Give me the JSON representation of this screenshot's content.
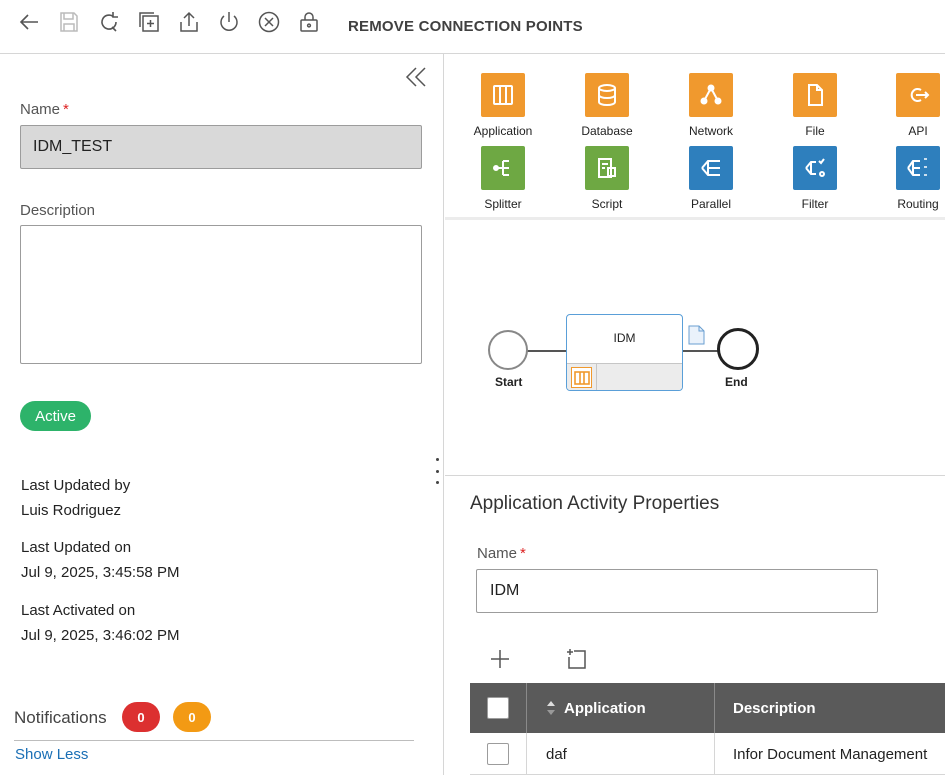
{
  "toolbar": {
    "title": "REMOVE CONNECTION POINTS",
    "icons": [
      "back-arrow-icon",
      "save-icon",
      "refresh-icon",
      "copy-icon",
      "export-icon",
      "power-icon",
      "cancel-circle-icon",
      "lock-icon"
    ]
  },
  "left": {
    "name_label": "Name",
    "required_mark": "*",
    "name_value": "IDM_TEST",
    "description_label": "Description",
    "description_value": "",
    "status": "Active",
    "last_updated_by_label": "Last Updated by",
    "last_updated_by": "Luis Rodriguez",
    "last_updated_on_label": "Last Updated on",
    "last_updated_on": "Jul 9, 2025, 3:45:58 PM",
    "last_activated_on_label": "Last Activated on",
    "last_activated_on": "Jul 9, 2025, 3:46:02 PM",
    "notifications_label": "Notifications",
    "notifications_red": "0",
    "notifications_orange": "0",
    "show_less": "Show Less"
  },
  "palette": {
    "items": [
      {
        "label": "Application",
        "icon": "application-icon",
        "color": "#f0992e"
      },
      {
        "label": "Database",
        "icon": "database-icon",
        "color": "#f0992e"
      },
      {
        "label": "Network",
        "icon": "network-icon",
        "color": "#f0992e"
      },
      {
        "label": "File",
        "icon": "file-icon",
        "color": "#f0992e"
      },
      {
        "label": "API",
        "icon": "api-icon",
        "color": "#f0992e"
      },
      {
        "label": "Splitter",
        "icon": "splitter-icon",
        "color": "#6ea843"
      },
      {
        "label": "Script",
        "icon": "script-icon",
        "color": "#6ea843"
      },
      {
        "label": "Parallel",
        "icon": "parallel-icon",
        "color": "#2e7fbd"
      },
      {
        "label": "Filter",
        "icon": "filter-icon",
        "color": "#2e7fbd"
      },
      {
        "label": "Routing",
        "icon": "routing-icon",
        "color": "#2e7fbd"
      }
    ]
  },
  "flow": {
    "start_label": "Start",
    "activity_label": "IDM",
    "end_label": "End"
  },
  "properties": {
    "title": "Application Activity Properties",
    "name_label": "Name",
    "required_mark": "*",
    "name_value": "IDM",
    "table": {
      "headers": [
        "Application",
        "Description"
      ],
      "rows": [
        {
          "application": "daf",
          "description": "Infor Document Management"
        }
      ]
    }
  },
  "colors": {
    "accent_orange": "#f0992e",
    "accent_green": "#6ea843",
    "accent_blue": "#2e7fbd",
    "active_green": "#2db36a",
    "badge_red": "#dc3030",
    "badge_orange": "#f39a14",
    "link_blue": "#1a6fb5"
  }
}
